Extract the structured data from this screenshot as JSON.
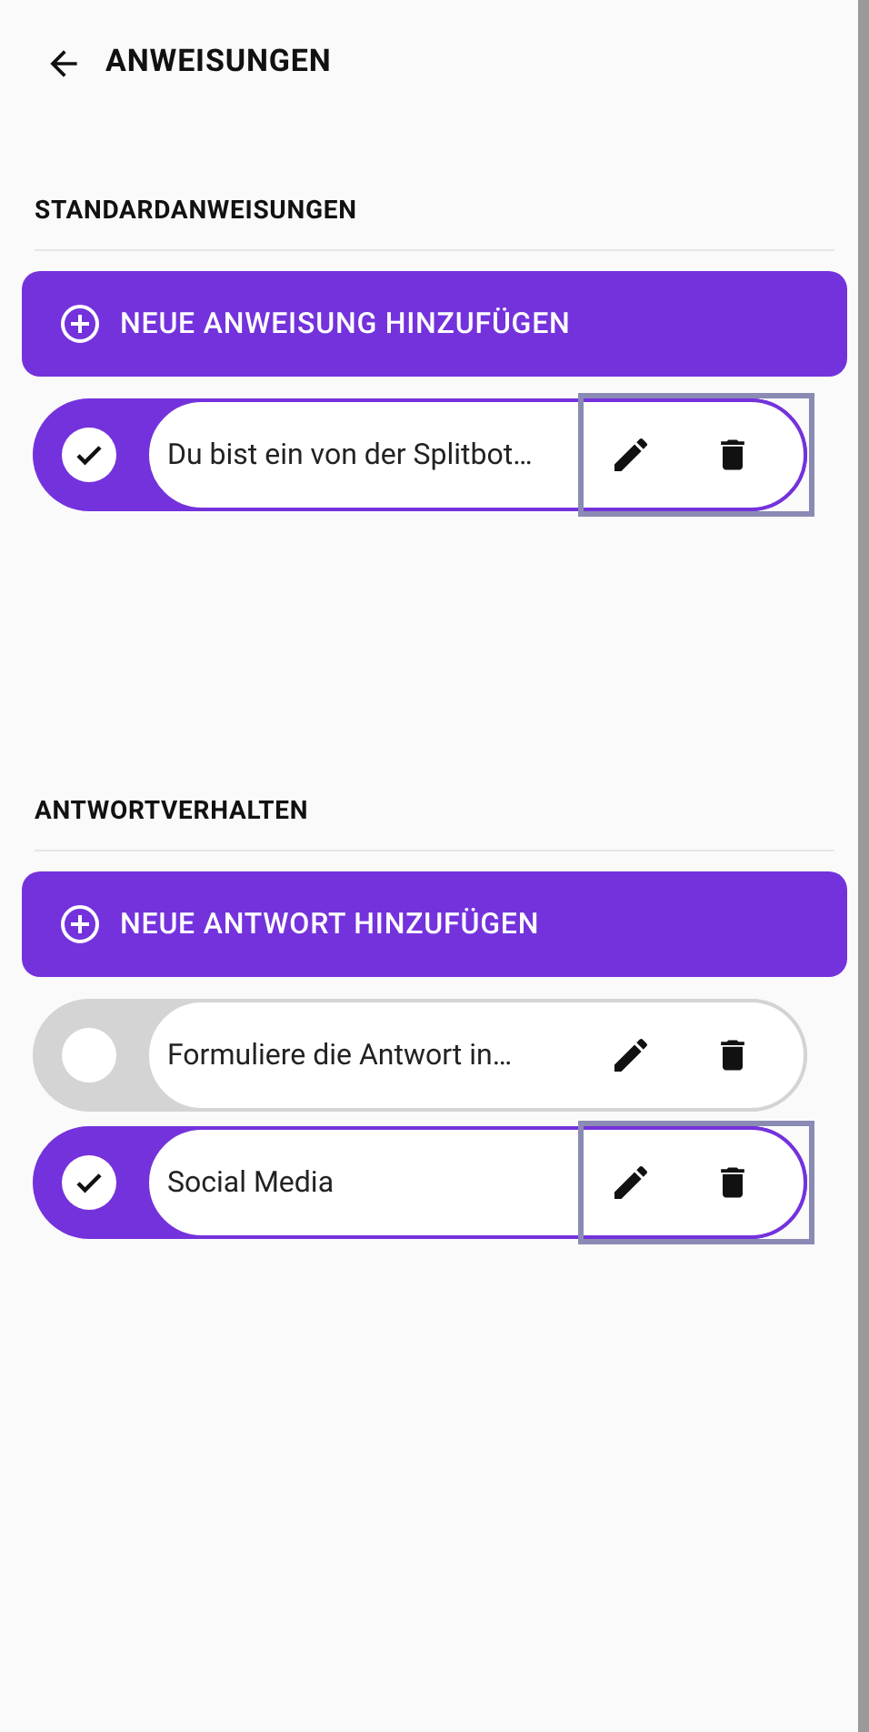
{
  "header": {
    "title": "ANWEISUNGEN"
  },
  "sections": [
    {
      "heading": "STANDARDANWEISUNGEN",
      "add_button": "NEUE ANWEISUNG HINZUFÜGEN",
      "items": [
        {
          "text": "Du bist ein von der Splitbot…",
          "checked": true,
          "highlighted": true
        }
      ]
    },
    {
      "heading": "ANTWORTVERHALTEN",
      "add_button": "NEUE ANTWORT HINZUFÜGEN",
      "items": [
        {
          "text": "Formuliere die Antwort in…",
          "checked": false,
          "highlighted": false
        },
        {
          "text": "Social Media",
          "checked": true,
          "highlighted": true
        }
      ]
    }
  ]
}
